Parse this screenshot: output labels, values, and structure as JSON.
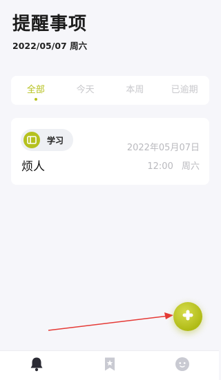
{
  "header": {
    "title": "提醒事项",
    "date": "2022/05/07 周六"
  },
  "tabs": [
    {
      "label": "全部",
      "active": true
    },
    {
      "label": "今天",
      "active": false
    },
    {
      "label": "本周",
      "active": false
    },
    {
      "label": "已逾期",
      "active": false
    }
  ],
  "reminder": {
    "category": "学习",
    "date": "2022年05月07日",
    "title": "烦人",
    "time": "12:00",
    "weekday": "周六"
  },
  "fab": {
    "icon": "add-icon"
  },
  "bottom_nav": [
    {
      "icon": "bell-icon",
      "active": true
    },
    {
      "icon": "bookmark-star-icon",
      "active": false
    },
    {
      "icon": "smiley-face-icon",
      "active": false
    }
  ],
  "colors": {
    "accent": "#b6c11e",
    "background": "#f6f6fa",
    "muted_text": "#b9b9be",
    "annotation_arrow": "#e53935"
  }
}
